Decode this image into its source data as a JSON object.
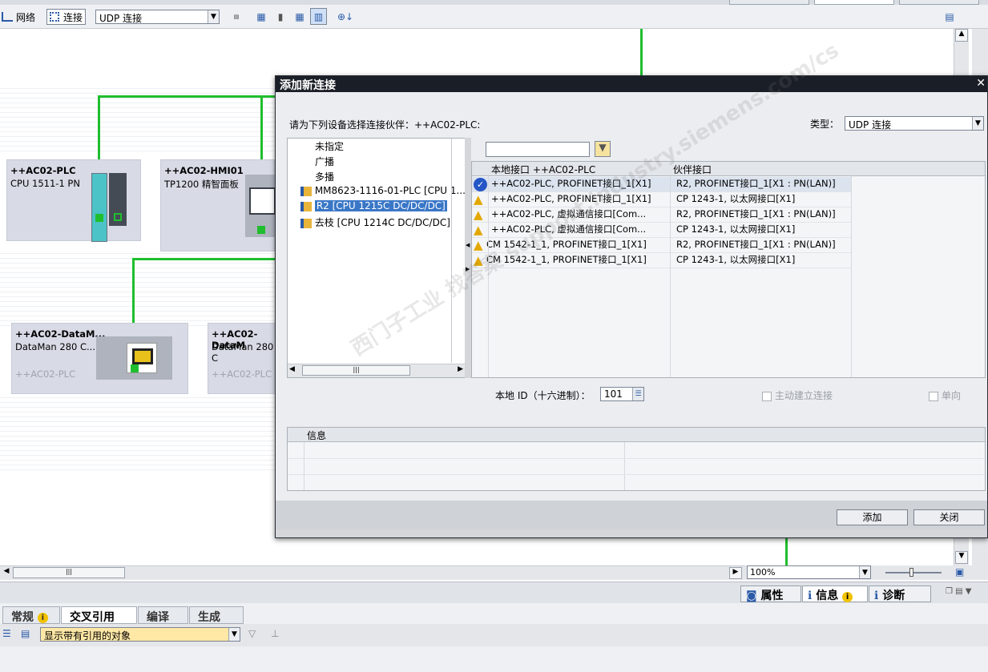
{
  "toolbar": {
    "network_label": "网络",
    "connection_label": "连接",
    "connection_type": "UDP 连接"
  },
  "devices": [
    {
      "name": "++AC02-PLC",
      "type": "CPU 1511-1 PN"
    },
    {
      "name": "++AC02-HMI01",
      "type": "TP1200 精智面板"
    },
    {
      "name": "++AC02-DataM...",
      "type": "DataMan 280 C...",
      "group": "++AC02-PLC"
    },
    {
      "name": "++AC02-DataM",
      "type": "DataMan 280 C",
      "group": "++AC02-PLC"
    }
  ],
  "dialog": {
    "title": "添加新连接",
    "prompt": "请为下列设备选择连接伙伴：++AC02-PLC:",
    "type_label": "类型：",
    "type_value": "UDP 连接",
    "tree_items": [
      {
        "label": "未指定",
        "icon": "none"
      },
      {
        "label": "广播",
        "icon": "none"
      },
      {
        "label": "多播",
        "icon": "none"
      },
      {
        "label": "MM8623-1116-01-PLC [CPU 1...",
        "icon": "plc-folder-icon"
      },
      {
        "label": "R2 [CPU 1215C DC/DC/DC]",
        "icon": "plc-folder-icon",
        "selected": true
      },
      {
        "label": "去枝 [CPU 1214C DC/DC/DC]",
        "icon": "plc-folder-icon"
      }
    ],
    "filter_placeholder": "",
    "table": {
      "col_local": "本地接口 ++AC02-PLC",
      "col_partner": "伙伴接口",
      "rows": [
        {
          "status": "ok",
          "local": "++AC02-PLC, PROFINET接口_1[X1]",
          "partner": "R2, PROFINET接口_1[X1 : PN(LAN)]",
          "selected": true
        },
        {
          "status": "warning",
          "local": "++AC02-PLC, PROFINET接口_1[X1]",
          "partner": "CP 1243-1, 以太网接口[X1]"
        },
        {
          "status": "warning",
          "local": "++AC02-PLC, 虚拟通信接口[Com...",
          "partner": "R2, PROFINET接口_1[X1 : PN(LAN)]"
        },
        {
          "status": "warning",
          "local": "++AC02-PLC, 虚拟通信接口[Com...",
          "partner": "CP 1243-1, 以太网接口[X1]"
        },
        {
          "status": "warning",
          "local": "CM 1542-1_1, PROFINET接口_1[X1]",
          "partner": "R2, PROFINET接口_1[X1 : PN(LAN)]"
        },
        {
          "status": "warning",
          "local": "CM 1542-1_1, PROFINET接口_1[X1]",
          "partner": "CP 1243-1, 以太网接口[X1]"
        }
      ]
    },
    "local_id_label": "本地 ID（十六进制）：",
    "local_id_value": "101",
    "active_conn_label": "主动建立连接",
    "oneway_label": "单向",
    "info_header": "信息",
    "add_button": "添加",
    "close_button": "关闭"
  },
  "zoom": "100%",
  "inspector_tabs": [
    {
      "label": "属性"
    },
    {
      "label": "信息"
    },
    {
      "label": "诊断"
    }
  ],
  "lower_tabs": [
    "常规",
    "交叉引用",
    "编译",
    "生成"
  ],
  "lower_filter": "显示带有引用的对象",
  "watermark": "西门子工业 找答案 support.industry.siemens.com/cs"
}
